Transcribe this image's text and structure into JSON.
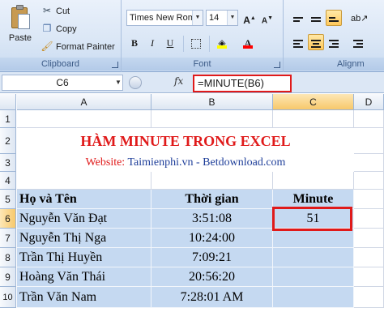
{
  "ribbon": {
    "clipboard": {
      "paste_label": "Paste",
      "cut_label": "Cut",
      "copy_label": "Copy",
      "format_painter_label": "Format Painter",
      "group_label": "Clipboard"
    },
    "font": {
      "font_name": "Times New Rom",
      "font_size": "14",
      "bold": "B",
      "italic": "I",
      "underline": "U",
      "group_label": "Font"
    },
    "alignment": {
      "group_label": "Alignm"
    },
    "colors": {
      "highlight": "#ffff00",
      "font_color": "#ff0000"
    }
  },
  "formula_bar": {
    "name_box": "C6",
    "fx": "fx",
    "formula": "=MINUTE(B6)"
  },
  "columns": [
    "A",
    "B",
    "C",
    "D"
  ],
  "rows": [
    "1",
    "2",
    "3",
    "4",
    "5",
    "6",
    "7",
    "8",
    "9",
    "10"
  ],
  "sheet": {
    "title": "HÀM MINUTE TRONG EXCEL",
    "website_prefix": "Website: ",
    "website_urls": "Taimienphi.vn - Betdownload.com",
    "headers": [
      "Họ và Tên",
      "Thời gian",
      "Minute"
    ],
    "data_rows": [
      {
        "name": "Nguyễn Văn Đạt",
        "time": "3:51:08",
        "minute": "51"
      },
      {
        "name": "Nguyễn Thị Nga",
        "time": "10:24:00",
        "minute": ""
      },
      {
        "name": "Trần Thị Huyền",
        "time": "7:09:21",
        "minute": ""
      },
      {
        "name": "Hoàng Văn Thái",
        "time": "20:56:20",
        "minute": ""
      },
      {
        "name": "Trần Văn Nam",
        "time": "7:28:01 AM",
        "minute": ""
      }
    ]
  }
}
